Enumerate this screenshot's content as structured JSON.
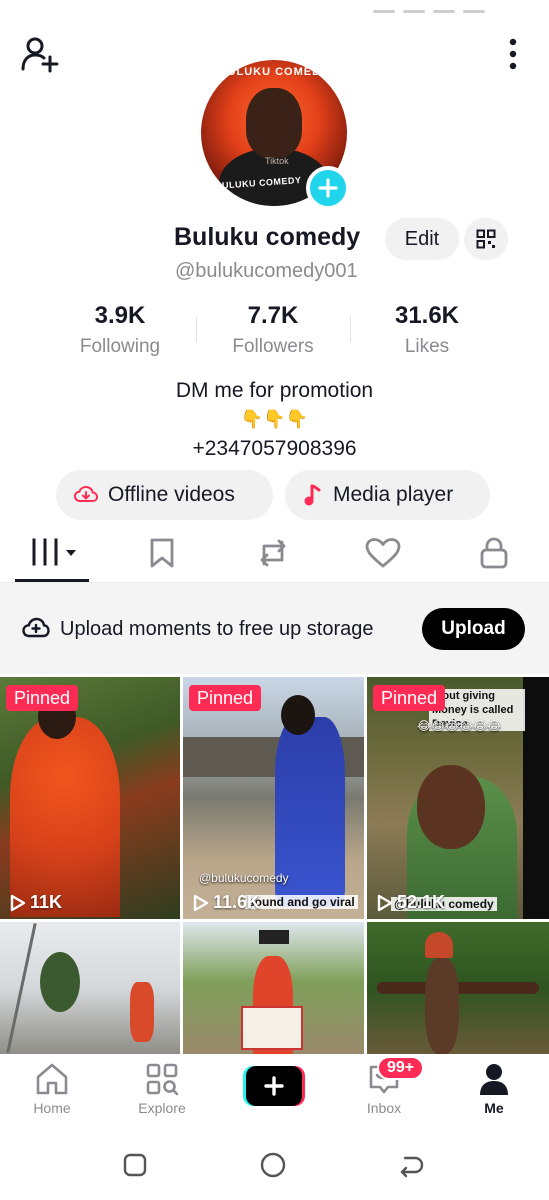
{
  "profile": {
    "display_name": "Buluku comedy",
    "username": "@bulukucomedy001",
    "edit_label": "Edit",
    "avatar_ring_text": "BULUKU COMEDY",
    "avatar_watermark": "Tiktok",
    "avatar_caption": "BULUKU COMEDY"
  },
  "stats": [
    {
      "value": "3.9K",
      "label": "Following"
    },
    {
      "value": "7.7K",
      "label": "Followers"
    },
    {
      "value": "31.6K",
      "label": "Likes"
    }
  ],
  "bio": {
    "line1": "DM me for promotion",
    "line2": "👇👇👇",
    "line3": "+2347057908396"
  },
  "pills": {
    "offline": "Offline videos",
    "media": "Media player"
  },
  "tabs": [
    "videos-grid-icon",
    "bookmark-icon",
    "repost-icon",
    "heart-icon",
    "lock-icon"
  ],
  "upload_bar": {
    "text": "Upload moments to free up storage",
    "button": "Upload"
  },
  "videos": [
    {
      "pinned": "Pinned",
      "views": "11K"
    },
    {
      "pinned": "Pinned",
      "views": "11.6K",
      "overlay_top": "@bulukucomedy",
      "overlay_caption": "sound and go viral"
    },
    {
      "pinned": "Pinned",
      "views": "52.1K",
      "overlay_text": "thout giving Money is called Device",
      "overlay_emojis": "😂😂😂😂😂😂",
      "overlay_handle": "@buluku comedy"
    },
    {},
    {},
    {}
  ],
  "nav": {
    "home": "Home",
    "explore": "Explore",
    "inbox": "Inbox",
    "me": "Me",
    "inbox_badge": "99+"
  },
  "colors": {
    "accent_pink": "#fe2c55",
    "accent_cyan": "#20d5ec",
    "text": "#161823",
    "muted": "#8a8b91"
  }
}
